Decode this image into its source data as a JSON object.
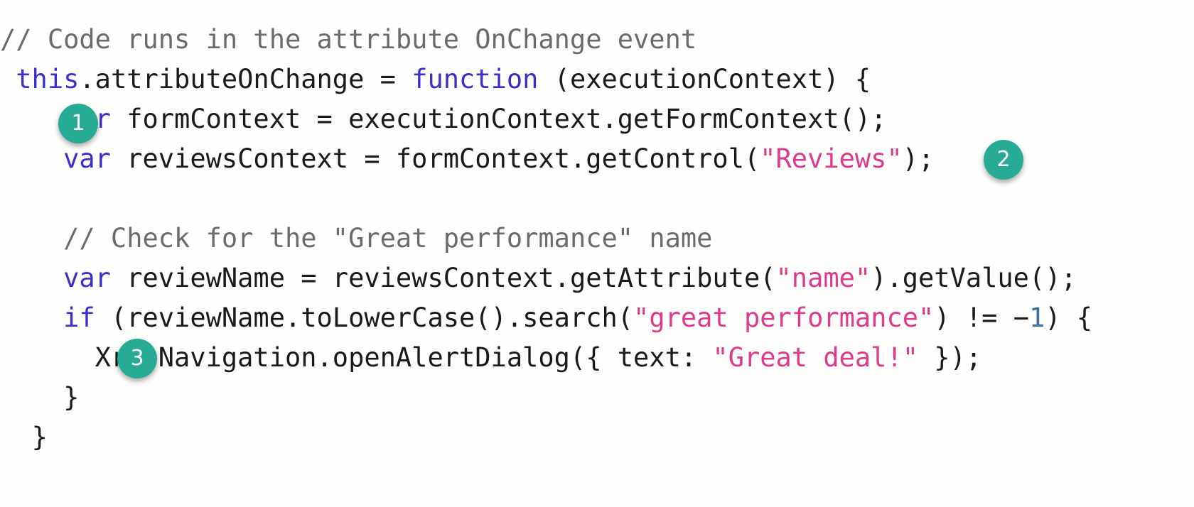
{
  "snippet": {
    "language": "javascript",
    "background_color": "#fdfdfb",
    "colors": {
      "comment": "#6b6b6b",
      "keyword": "#3b2fc9",
      "string": "#dd3b8c",
      "number": "#3d6e9e",
      "plain": "#1a1a1a",
      "badge_fill": "#27ab95",
      "badge_text": "#ffffff"
    },
    "lines": [
      {
        "indent": "",
        "tokens": [
          {
            "t": "comment",
            "v": "// Code runs in the attribute OnChange event"
          }
        ]
      },
      {
        "indent": " ",
        "tokens": [
          {
            "t": "keyword",
            "v": "this"
          },
          {
            "t": "plain",
            "v": ".attributeOnChange = "
          },
          {
            "t": "keyword",
            "v": "function"
          },
          {
            "t": "plain",
            "v": " (executionContext) {"
          }
        ]
      },
      {
        "indent": "    ",
        "tokens": [
          {
            "t": "keyword",
            "v": "var"
          },
          {
            "t": "plain",
            "v": " formContext = executionContext.getFormContext();"
          }
        ]
      },
      {
        "indent": "    ",
        "tokens": [
          {
            "t": "keyword",
            "v": "var"
          },
          {
            "t": "plain",
            "v": " reviewsContext = formContext.getControl("
          },
          {
            "t": "string",
            "v": "\"Reviews\""
          },
          {
            "t": "plain",
            "v": ");"
          }
        ]
      },
      {
        "indent": "",
        "tokens": []
      },
      {
        "indent": "    ",
        "tokens": [
          {
            "t": "comment",
            "v": "// Check for the \"Great performance\" name"
          }
        ]
      },
      {
        "indent": "    ",
        "tokens": [
          {
            "t": "keyword",
            "v": "var"
          },
          {
            "t": "plain",
            "v": " reviewName = reviewsContext.getAttribute("
          },
          {
            "t": "string",
            "v": "\"name\""
          },
          {
            "t": "plain",
            "v": ").getValue();"
          }
        ]
      },
      {
        "indent": "    ",
        "tokens": [
          {
            "t": "keyword",
            "v": "if"
          },
          {
            "t": "plain",
            "v": " (reviewName.toLowerCase().search("
          },
          {
            "t": "string",
            "v": "\"great performance\""
          },
          {
            "t": "plain",
            "v": ") != −"
          },
          {
            "t": "number",
            "v": "1"
          },
          {
            "t": "plain",
            "v": ") {"
          }
        ]
      },
      {
        "indent": "      ",
        "tokens": [
          {
            "t": "plain",
            "v": "Xrm.Navigation.openAlertDialog({ text: "
          },
          {
            "t": "string",
            "v": "\"Great deal!\""
          },
          {
            "t": "plain",
            "v": " });"
          }
        ]
      },
      {
        "indent": "    ",
        "tokens": [
          {
            "t": "plain",
            "v": "}"
          }
        ]
      },
      {
        "indent": "  ",
        "tokens": [
          {
            "t": "plain",
            "v": "}"
          }
        ]
      }
    ],
    "badges": [
      {
        "id": "badge-1",
        "label": "1"
      },
      {
        "id": "badge-2",
        "label": "2"
      },
      {
        "id": "badge-3",
        "label": "3"
      }
    ]
  }
}
